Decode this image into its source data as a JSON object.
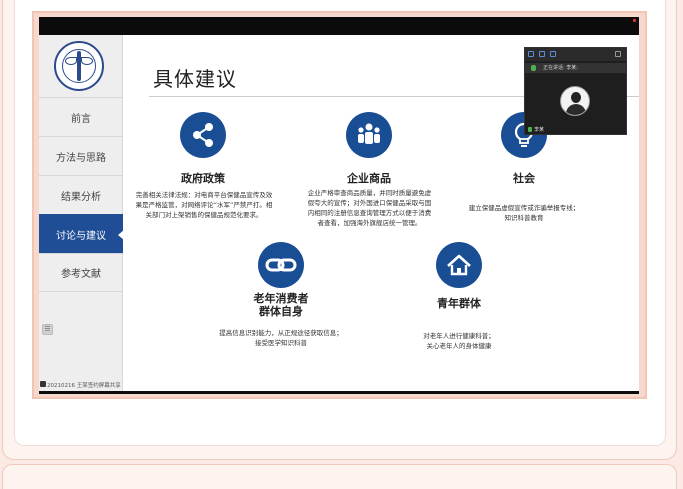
{
  "slide": {
    "title": "具体建议",
    "nav_items": [
      {
        "label": "前言",
        "active": false
      },
      {
        "label": "方法与思路",
        "active": false
      },
      {
        "label": "结果分析",
        "active": false
      },
      {
        "label": "讨论与建议",
        "active": true
      },
      {
        "label": "参考文献",
        "active": false
      }
    ],
    "suggestions": [
      {
        "icon": "share-icon",
        "heading": "政府政策",
        "lines": [
          "完善相关法律法规：对电商平台保健品宣传及效",
          "果是严格监管，对网络评论“水军”严禁严打。相",
          "关部门对上架销售的保健品规范化要求。"
        ]
      },
      {
        "icon": "group-icon",
        "heading": "企业商品",
        "lines": [
          "企业严格审查商品质量，并同时质量避免虚",
          "假夸大的宣传；对外国进口保健品采取与国",
          "内相同的注册信息查询管理方式以便于消费",
          "者查看，加强海外旗舰店统一管理。"
        ]
      },
      {
        "icon": "lightbulb-icon",
        "heading": "社会",
        "lines": [
          "建立保健品虚假宣传或诈骗举报专线；",
          "知识科普教育"
        ]
      },
      {
        "icon": "link-icon",
        "heading_lines": [
          "老年消费者",
          "群体自身"
        ],
        "lines": [
          "提高信息识别能力，从正规途径获取信息；",
          "接受医学知识科普"
        ]
      },
      {
        "icon": "home-icon",
        "heading": "青年群体",
        "lines": [
          "对老年人进行健康科普；",
          "关心老年人的身体健康"
        ]
      }
    ]
  },
  "video": {
    "title": "正在讲话: 李某;",
    "participant": "李某"
  },
  "footer": {
    "recording": "20210216 王某签约屏幕共享"
  },
  "colors": {
    "accent": "#1a4e94",
    "page_bg": "#fbe9e3"
  }
}
